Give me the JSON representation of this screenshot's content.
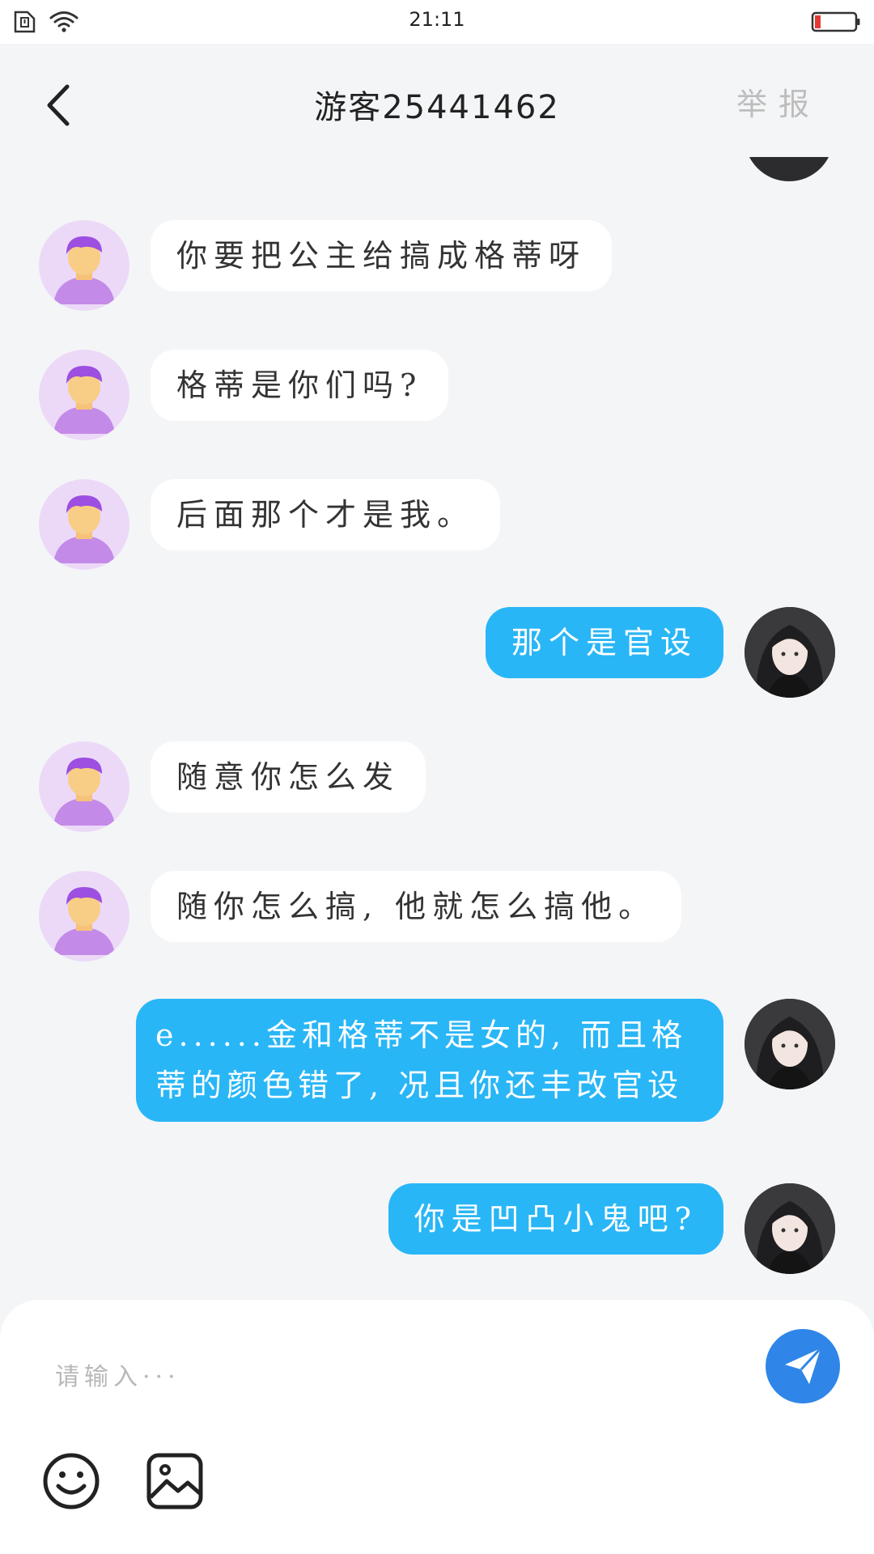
{
  "status_bar": {
    "time": "21:11",
    "icons": [
      "sim-icon",
      "wifi-icon",
      "battery-low-icon"
    ],
    "battery_color": "#e53935"
  },
  "header": {
    "back_icon": "chevron-left-icon",
    "title": "游客25441462",
    "report_label": "举报"
  },
  "colors": {
    "self_bubble": "#29b6f6",
    "guest_bubble": "#ffffff",
    "background": "#f4f5f7",
    "send_button": "#2f86e8",
    "guest_avatar_bg": "#ecd9f8"
  },
  "messages": [
    {
      "side": "left",
      "avatar": "guest-avatar",
      "text": "你要把公主给搞成格蒂呀"
    },
    {
      "side": "left",
      "avatar": "guest-avatar",
      "text": "格蒂是你们吗?"
    },
    {
      "side": "left",
      "avatar": "guest-avatar",
      "text": "后面那个才是我。"
    },
    {
      "side": "right",
      "avatar": "self-avatar",
      "text": "那个是官设"
    },
    {
      "side": "left",
      "avatar": "guest-avatar",
      "text": "随意你怎么发"
    },
    {
      "side": "left",
      "avatar": "guest-avatar",
      "text": "随你怎么搞, 他就怎么搞他。"
    },
    {
      "side": "right",
      "avatar": "self-avatar",
      "text": "e......金和格蒂不是女的, 而且格蒂的颜色错了, 况且你还丰改官设"
    },
    {
      "side": "right",
      "avatar": "self-avatar",
      "text": "你是凹凸小鬼吧?"
    }
  ],
  "composer": {
    "placeholder": "请输入···",
    "send_icon": "paper-plane-icon",
    "tools": [
      "emoji-icon",
      "image-icon"
    ]
  }
}
